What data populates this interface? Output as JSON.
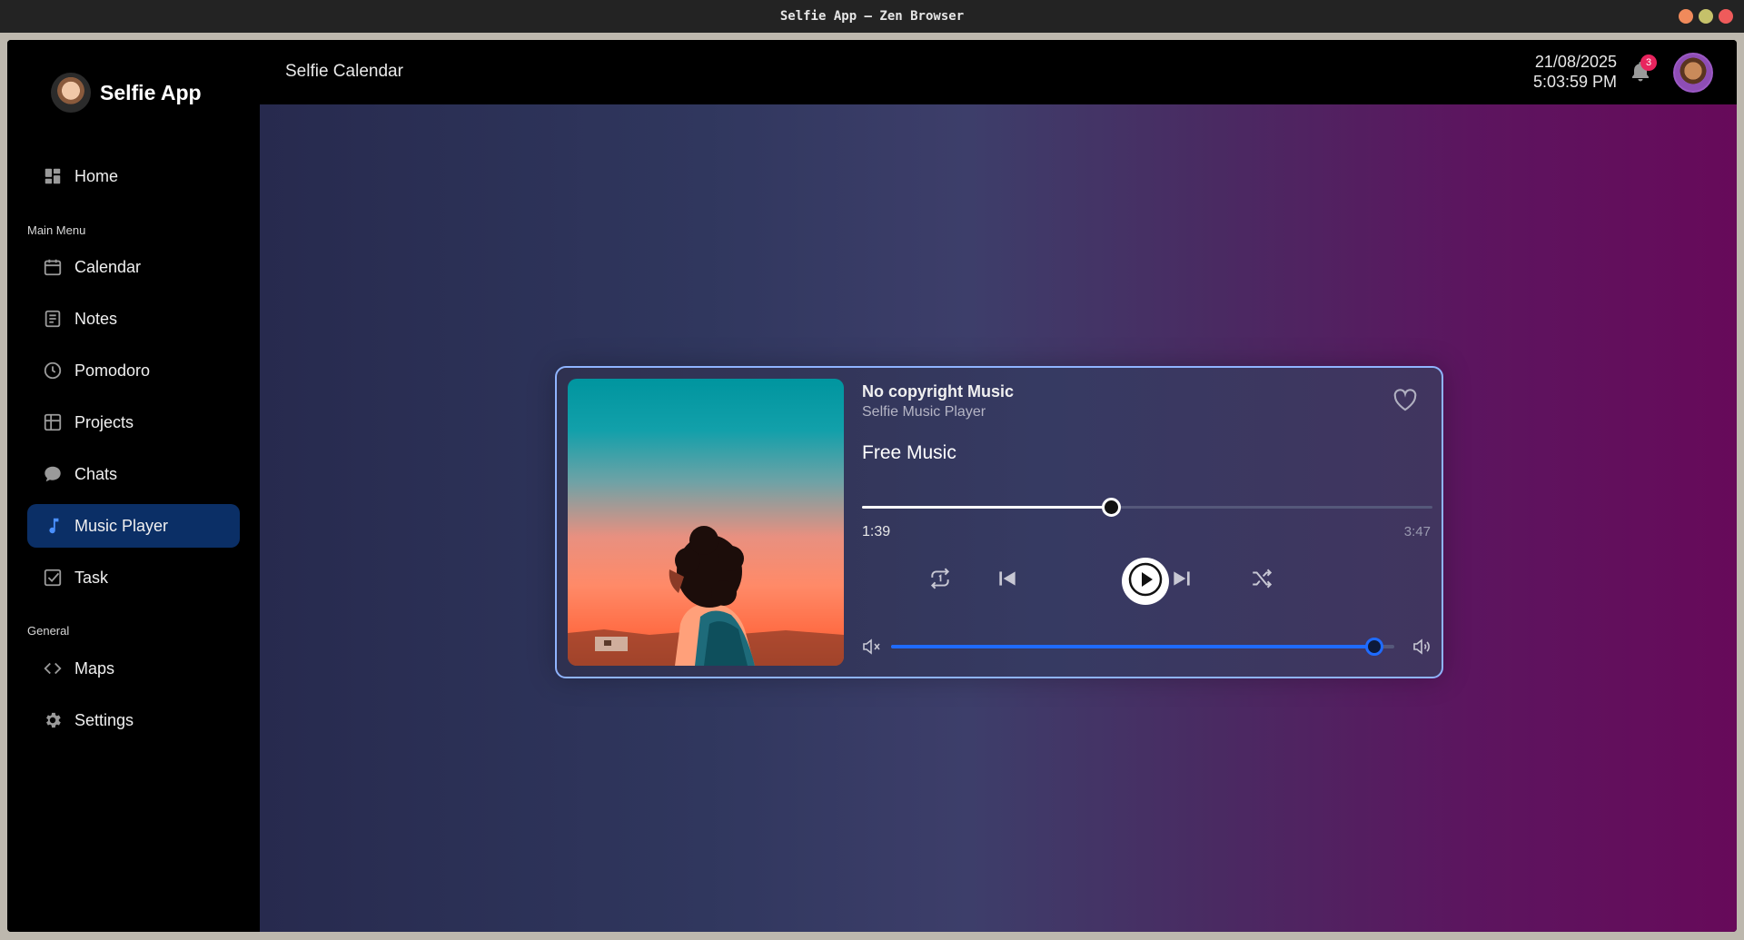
{
  "os": {
    "window_title": "Selfie App — Zen Browser",
    "controls": [
      {
        "name": "minimize",
        "color": "#f08a5b"
      },
      {
        "name": "maximize",
        "color": "#c5c16a"
      },
      {
        "name": "close",
        "color": "#ef5b5b"
      }
    ]
  },
  "brand": {
    "name": "Selfie App"
  },
  "sidebar": {
    "home": {
      "label": "Home",
      "icon": "dashboard-icon"
    },
    "main_menu_label": "Main Menu",
    "main_menu": [
      {
        "label": "Calendar",
        "icon": "calendar-icon"
      },
      {
        "label": "Notes",
        "icon": "notes-icon"
      },
      {
        "label": "Pomodoro",
        "icon": "clock-icon"
      },
      {
        "label": "Projects",
        "icon": "table-icon"
      },
      {
        "label": "Chats",
        "icon": "chat-bubble-icon"
      },
      {
        "label": "Music Player",
        "icon": "music-note-icon",
        "active": true
      },
      {
        "label": "Task",
        "icon": "checkbox-icon"
      }
    ],
    "general_label": "General",
    "general": [
      {
        "label": "Maps",
        "icon": "code-brackets-icon"
      },
      {
        "label": "Settings",
        "icon": "gear-icon"
      }
    ]
  },
  "header": {
    "title": "Selfie Calendar",
    "date": "21/08/2025",
    "time": "5:03:59 PM",
    "notification_count": "3"
  },
  "player": {
    "title": "No copyright Music",
    "subtitle": "Selfie Music Player",
    "album": "Free Music",
    "current_time": "1:39",
    "total_time": "3:47",
    "progress_fraction": 0.436,
    "volume_fraction": 0.96,
    "favorite": false
  },
  "colors": {
    "accent": "#1f6bff",
    "active_nav": "#0b2f66",
    "card_border": "#8fb4ff",
    "badge": "#e8245e"
  }
}
